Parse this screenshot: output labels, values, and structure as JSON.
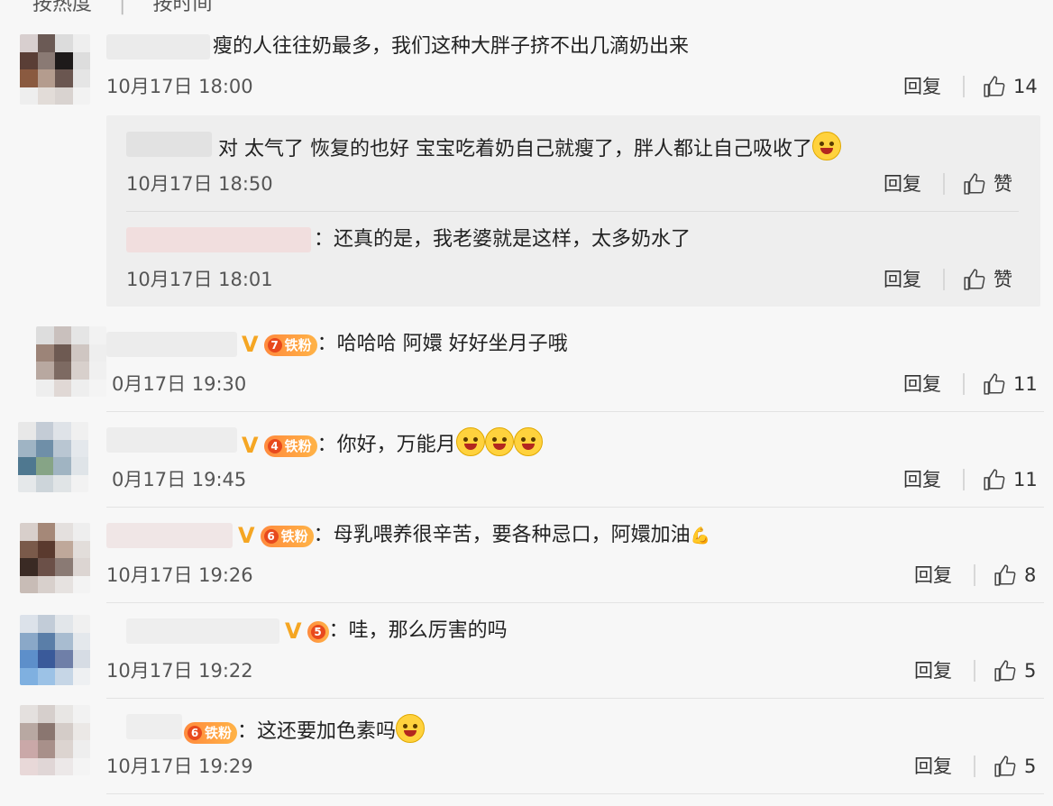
{
  "sort_tabs": [
    "按热度",
    "按时间"
  ],
  "comments": [
    {
      "text": "瘦的人往往奶最多，我们这种大胖子挤不出几滴奶出来",
      "time": "10月17日 18:00",
      "reply": "回复",
      "likes": "14"
    },
    {
      "text": "对 太气了  恢复的也好  宝宝吃着奶自己就瘦了，胖人都让自己吸收了",
      "time": "10月17日 18:50",
      "reply": "回复",
      "likes": "赞"
    },
    {
      "text": "：还真的是，我老婆就是这样，太多奶水了",
      "time": "10月17日 18:01",
      "reply": "回复",
      "likes": "赞"
    },
    {
      "badge": "铁粉",
      "level": "7",
      "text": "：哈哈哈  阿嬛  好好坐月子哦",
      "time": "0月17日 19:30",
      "reply": "回复",
      "likes": "11"
    },
    {
      "badge": "铁粉",
      "level": "4",
      "text": "：你好，万能月",
      "time": "0月17日 19:45",
      "reply": "回复",
      "likes": "11"
    },
    {
      "badge": "铁粉",
      "level": "6",
      "text": "：母乳喂养很辛苦，要各种忌口，阿嬛加油",
      "time": "10月17日 19:26",
      "reply": "回复",
      "likes": "8"
    },
    {
      "level": "5",
      "text": "：哇，那么厉害的吗",
      "time": "10月17日 19:22",
      "reply": "回复",
      "likes": "5"
    },
    {
      "badge": "铁粉",
      "level": "6",
      "text": "：这还要加色素吗",
      "time": "10月17日 19:29",
      "reply": "回复",
      "likes": "5"
    }
  ],
  "verified_mark": "V",
  "icons": {
    "like": "thumbs-up-icon",
    "emoji": "emoji-icon"
  },
  "colors": {
    "background": "#f7f7f7",
    "subreply_bg": "#eeeeee",
    "badge": "#ff8a3d",
    "verified": "#f5a623"
  }
}
